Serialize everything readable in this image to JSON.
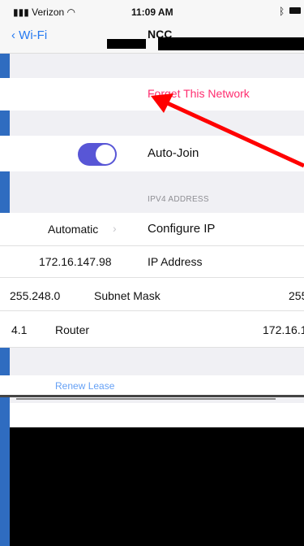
{
  "status_bar": {
    "carrier": "Verizon",
    "time": "11:09 AM"
  },
  "nav": {
    "back_label": "Wi-Fi",
    "title": "NCC"
  },
  "forget": {
    "label": "Forget This Network"
  },
  "autojoin": {
    "label": "Auto-Join",
    "enabled": true
  },
  "ipv4": {
    "header": "IPV4 ADDRESS",
    "configure_value": "Automatic",
    "configure_label": "Configure IP",
    "ip_value": "172.16.147.98",
    "ip_label": "IP Address",
    "subnet_value": "255.248.0",
    "subnet_label": "Subnet Mask",
    "subnet_right": "255",
    "router_left": "4.1",
    "router_label": "Router",
    "router_right": "172.16.1"
  },
  "renew": {
    "label": "Renew Lease"
  },
  "colors": {
    "accent": "#2479f1",
    "destructive": "#ff2d6f",
    "toggle_on": "#5856d6",
    "arrow": "#ff0000"
  }
}
